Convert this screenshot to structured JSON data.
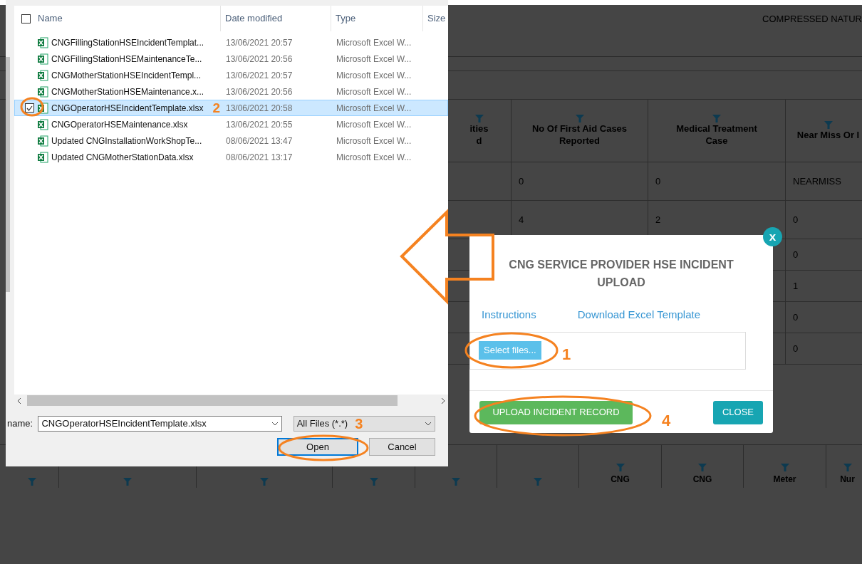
{
  "background_page": {
    "header": "COMPRESSED NATUR",
    "table": {
      "columns": [
        {
          "lines": [
            "ities",
            "d"
          ]
        },
        {
          "lines": [
            "No Of First Aid Cases",
            "Reported"
          ]
        },
        {
          "lines": [
            "Medical Treatment",
            "Case"
          ]
        },
        {
          "lines": [
            "Near Miss Or I"
          ]
        }
      ],
      "rows": [
        [
          null,
          "0",
          "0",
          "NEARMISS"
        ],
        [
          null,
          "4",
          "2",
          "0"
        ],
        [
          null,
          null,
          null,
          "0"
        ],
        [
          null,
          null,
          null,
          "1"
        ],
        [
          null,
          null,
          null,
          "0"
        ],
        [
          null,
          null,
          null,
          "0"
        ]
      ]
    },
    "bottom_table": {
      "columns": [
        {},
        {},
        {},
        {},
        {},
        {},
        {
          "label": "CNG"
        },
        {
          "label": "CNG"
        },
        {
          "label": "Meter"
        },
        {
          "label": "Nur"
        }
      ]
    }
  },
  "file_dialog": {
    "select_all_checked": false,
    "columns": [
      "Name",
      "Date modified",
      "Type",
      "Size"
    ],
    "files": [
      {
        "name": "CNGFillingStationHSEIncidentTemplat...",
        "date": "13/06/2021 20:57",
        "type": "Microsoft Excel W...",
        "selected": false
      },
      {
        "name": "CNGFillingStationHSEMaintenanceTe...",
        "date": "13/06/2021 20:56",
        "type": "Microsoft Excel W...",
        "selected": false
      },
      {
        "name": "CNGMotherStationHSEIncidentTempl...",
        "date": "13/06/2021 20:57",
        "type": "Microsoft Excel W...",
        "selected": false
      },
      {
        "name": "CNGMotherStationHSEMaintenance.x...",
        "date": "13/06/2021 20:56",
        "type": "Microsoft Excel W...",
        "selected": false
      },
      {
        "name": "CNGOperatorHSEIncidentTemplate.xlsx",
        "date": "13/06/2021 20:58",
        "type": "Microsoft Excel W...",
        "selected": true
      },
      {
        "name": "CNGOperatorHSEMaintenance.xlsx",
        "date": "13/06/2021 20:55",
        "type": "Microsoft Excel W...",
        "selected": false
      },
      {
        "name": "Updated CNGInstallationWorkShopTe...",
        "date": "08/06/2021 13:47",
        "type": "Microsoft Excel W...",
        "selected": false
      },
      {
        "name": "Updated CNGMotherStationData.xlsx",
        "date": "08/06/2021 13:17",
        "type": "Microsoft Excel W...",
        "selected": false
      }
    ],
    "file_name_label": "name:",
    "file_name": "CNGOperatorHSEIncidentTemplate.xlsx",
    "file_type": "All Files (*.*)",
    "buttons": [
      "Open",
      "Cancel"
    ]
  },
  "upload_modal": {
    "close_icon": "x",
    "title": "CNG SERVICE PROVIDER HSE INCIDENT UPLOAD",
    "links": [
      "Instructions",
      "Download Excel Template"
    ],
    "select_button": "Select files...",
    "upload_button": "UPLOAD INCIDENT RECORD",
    "close_button": "CLOSE"
  },
  "annotations": [
    "1",
    "2",
    "3",
    "4"
  ]
}
